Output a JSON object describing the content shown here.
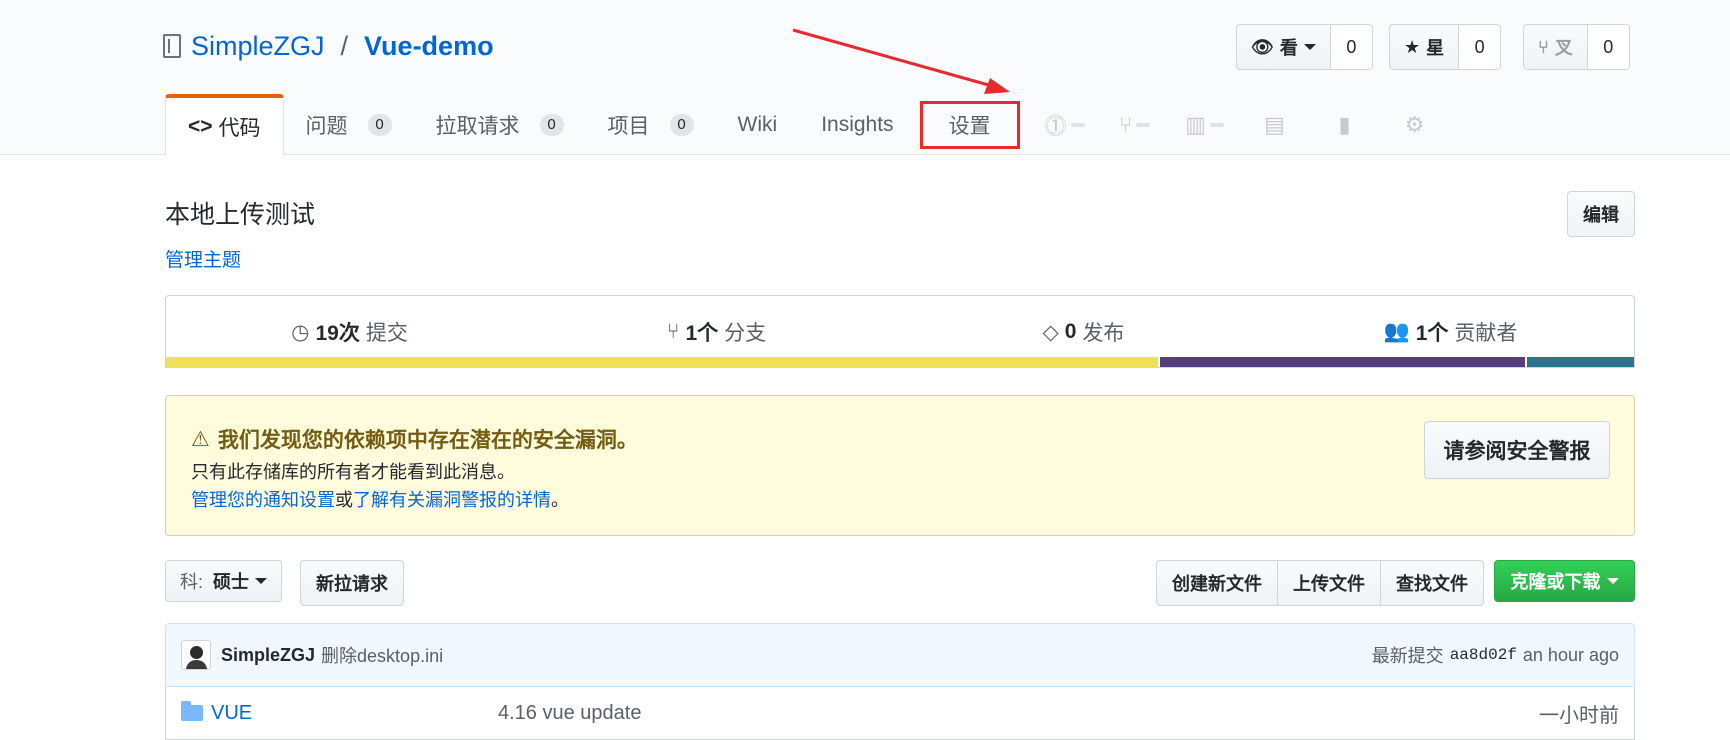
{
  "repo": {
    "owner": "SimpleZGJ",
    "separator": "/",
    "name": "Vue-demo"
  },
  "header_actions": {
    "watch": {
      "label": "看",
      "count": "0"
    },
    "star": {
      "label": "星",
      "count": "0"
    },
    "fork": {
      "label": "叉",
      "count": "0"
    }
  },
  "tabs": {
    "code": "代码",
    "issues": "问题",
    "issues_count": "0",
    "pulls": "拉取请求",
    "pulls_count": "0",
    "projects": "项目",
    "projects_count": "0",
    "wiki": "Wiki",
    "insights": "Insights",
    "settings": "设置"
  },
  "extra_tab_icons": [
    "issue-opened-icon",
    "pull-request-icon",
    "project-icon",
    "book-icon",
    "graph-icon",
    "gear-icon"
  ],
  "description": "本地上传测试",
  "topics_link": "管理主题",
  "edit_button": "编辑",
  "summary": {
    "commits_num": "19次",
    "commits_label": "提交",
    "branches_num": "1个",
    "branches_label": "分支",
    "releases_num": "0",
    "releases_label": "发布",
    "contributors_num": "1个",
    "contributors_label": "贡献者"
  },
  "language_colors": [
    "#f1e05a",
    "#563d7c",
    "#2b7489"
  ],
  "language_shares": [
    0.676,
    0.25,
    0.074
  ],
  "alert": {
    "title": "我们发现您的依赖项中存在潜在的安全漏洞。",
    "line1": "只有此存储库的所有者才能看到此消息。",
    "link1": "管理您的通知设置",
    "connector": "或",
    "link2": "了解有关漏洞警报的详情",
    "period": "。",
    "button": "请参阅安全警报"
  },
  "file_nav": {
    "branch_label": "科:",
    "branch_value": "硕士",
    "new_pr": "新拉请求",
    "create_file": "创建新文件",
    "upload_file": "上传文件",
    "find_file": "查找文件",
    "clone": "克隆或下载"
  },
  "commit": {
    "author": "SimpleZGJ",
    "message": "删除desktop.ini",
    "latest_label": "最新提交",
    "sha": "aa8d02f",
    "age": "an hour ago"
  },
  "files": [
    {
      "name": "VUE",
      "message": "4.16 vue update",
      "age": "一小时前"
    }
  ]
}
